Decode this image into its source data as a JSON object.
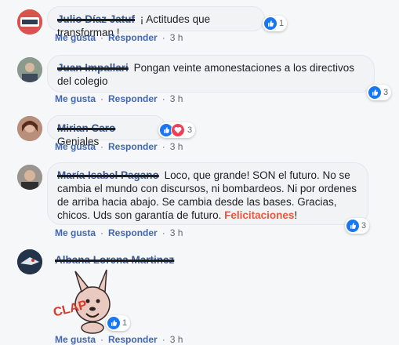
{
  "colors": {
    "link": "#4267b2",
    "author": "#385898",
    "highlight": "#e9573f",
    "like": "#1877f2",
    "love": "#f33e58"
  },
  "actions": {
    "like": "Me gusta",
    "reply": "Responder"
  },
  "comments": [
    {
      "author": "Julio Díaz Jatuf",
      "text": "¡ Actitudes que transforman !",
      "time": "3 h",
      "reactions": "1",
      "reaction_icons": [
        "like-icon"
      ]
    },
    {
      "author": "Juan Impallari",
      "text": "Pongan veinte amonestaciones a los directivos del colegio",
      "time": "3 h",
      "reactions": "3",
      "reaction_icons": [
        "like-icon"
      ]
    },
    {
      "author": "Mirian Caro",
      "text": "Geniales",
      "time": "3 h",
      "reactions": "3",
      "reaction_icons": [
        "like-icon",
        "love-icon"
      ]
    },
    {
      "author": "María Isabel Pagano",
      "text": "Loco, que grande! SON el futuro. No se cambia el mundo con discursos, ni bombardeos. Ni por ordenes de arriba hacia abajo. Se cambia desde las bases. Gracias, chicos. Uds son garantía de futuro.",
      "highlight": "Felicitaciones",
      "trailing": "!",
      "time": "3 h",
      "reactions": "3",
      "reaction_icons": [
        "like-icon"
      ]
    },
    {
      "author": "Albana Lorena Martinez",
      "text": "",
      "sticker": "CLAP",
      "time": "3 h",
      "reactions": "1",
      "reaction_icons": [
        "like-icon"
      ]
    }
  ]
}
